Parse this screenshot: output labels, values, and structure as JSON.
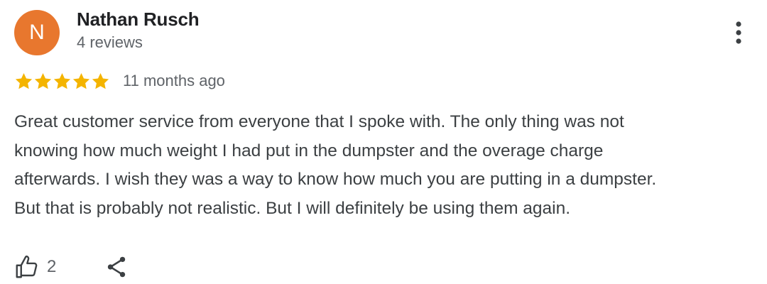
{
  "review": {
    "author": {
      "initial": "N",
      "name": "Nathan Rusch",
      "reviews_count": "4 reviews",
      "avatar_color": "#e8772e"
    },
    "rating": {
      "value": 5,
      "max": 5,
      "star_color": "#f4b400"
    },
    "date": "11 months ago",
    "text": "Great customer service from everyone that I spoke with. The only thing was not\nknowing how much weight I had put in the dumpster and the overage charge\nafterwards. I wish they was a way to know how much you are putting in a dumpster.\nBut that is probably not realistic. But I will definitely be using them again.",
    "actions": {
      "like_count": "2",
      "like_icon": "thumbs-up-icon",
      "share_icon": "share-icon",
      "more_icon": "more-vertical-icon"
    }
  }
}
